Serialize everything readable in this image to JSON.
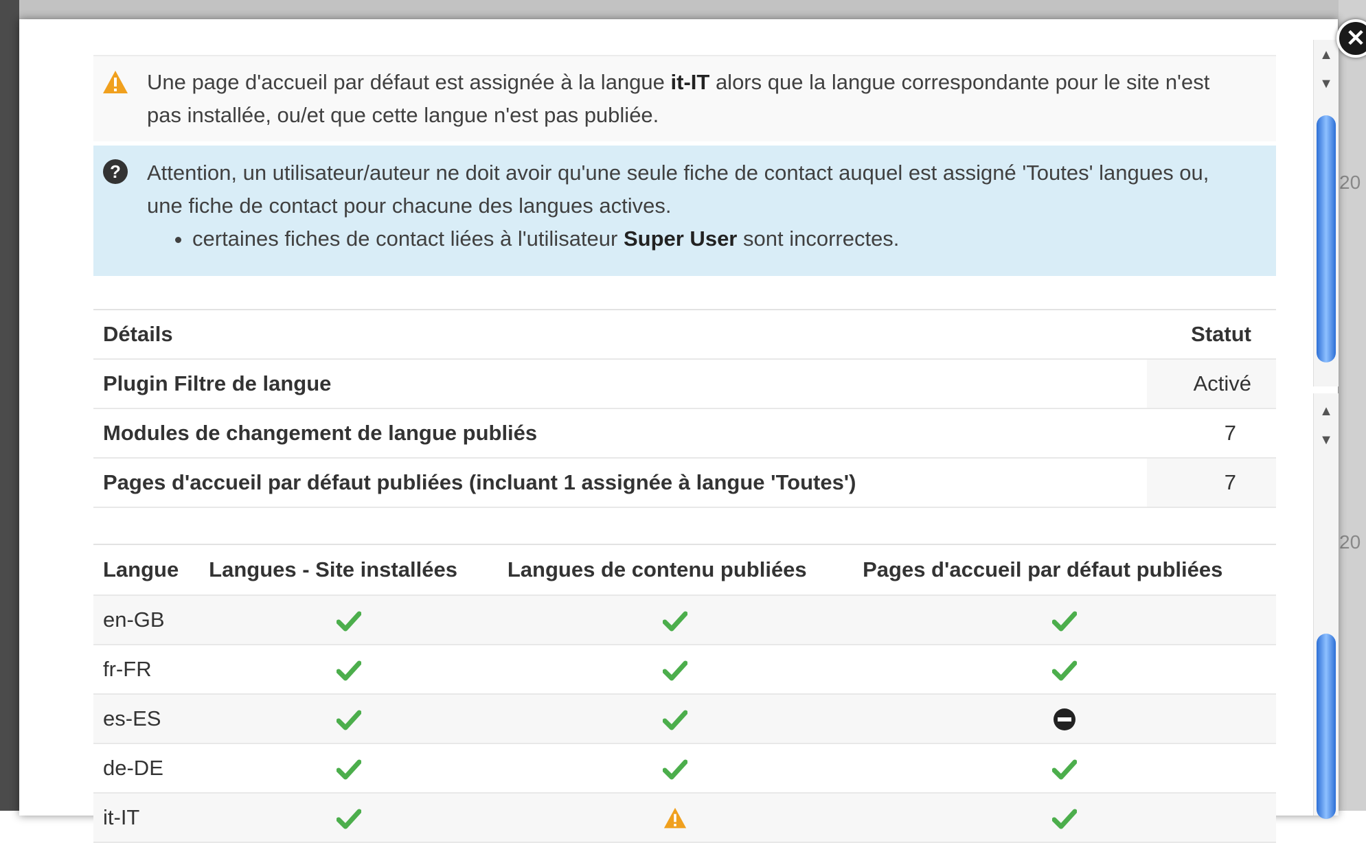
{
  "modal": {
    "close_label": "close"
  },
  "alerts": {
    "warning": {
      "icon": "warning-icon",
      "text_before": "Une page d'accueil par défaut est assignée à la langue ",
      "language": "it-IT",
      "text_after": " alors que la langue correspondante pour le site n'est pas installée, ou/et que cette langue n'est pas publiée."
    },
    "info": {
      "icon": "question-circle-icon",
      "text": "Attention, un utilisateur/auteur ne doit avoir qu'une seule fiche de contact auquel est assigné 'Toutes' langues ou, une fiche de contact pour chacune des langues actives.",
      "bullet_before": "certaines fiches de contact liées à l'utilisateur ",
      "bullet_user": "Super User",
      "bullet_after": " sont incorrectes."
    }
  },
  "details_table": {
    "headers": [
      "Détails",
      "Statut"
    ],
    "rows": [
      {
        "label": "Plugin Filtre de langue",
        "value": "Activé"
      },
      {
        "label": "Modules de changement de langue publiés",
        "value": "7"
      },
      {
        "label": "Pages d'accueil par défaut publiées (incluant 1 assignée à langue 'Toutes')",
        "value": "7"
      }
    ]
  },
  "languages_table": {
    "headers": [
      "Langue",
      "Langues - Site installées",
      "Langues de contenu publiées",
      "Pages d'accueil par défaut publiées"
    ],
    "rows": [
      {
        "lang": "en-GB",
        "site": "check-icon",
        "content": "check-icon",
        "home": "check-icon"
      },
      {
        "lang": "fr-FR",
        "site": "check-icon",
        "content": "check-icon",
        "home": "check-icon"
      },
      {
        "lang": "es-ES",
        "site": "check-icon",
        "content": "check-icon",
        "home": "minus-circle-icon"
      },
      {
        "lang": "de-DE",
        "site": "check-icon",
        "content": "check-icon",
        "home": "check-icon"
      },
      {
        "lang": "it-IT",
        "site": "check-icon",
        "content": "warning-icon",
        "home": "check-icon"
      }
    ]
  },
  "background": {
    "fragments": [
      "20",
      "20"
    ]
  },
  "colors": {
    "check": "#4cae4c",
    "warning": "#f0a01e",
    "info_bg": "#d9edf7"
  }
}
